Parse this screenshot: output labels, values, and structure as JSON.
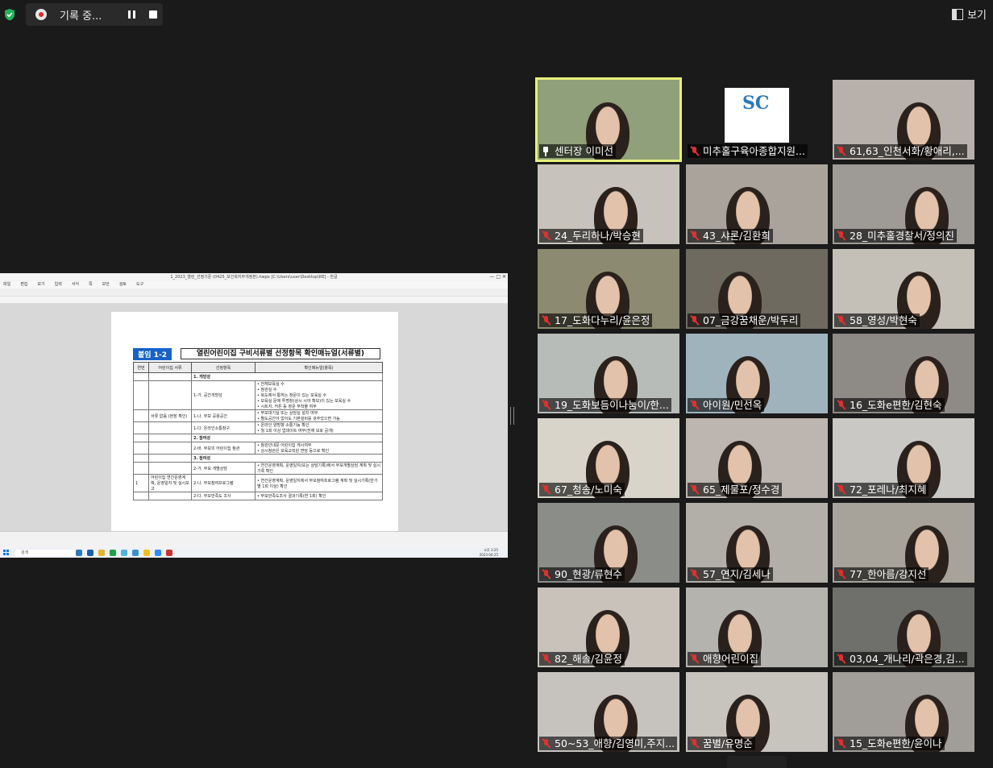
{
  "recording": {
    "label": "기록 중..."
  },
  "view_button": {
    "label": "보기"
  },
  "shared_screen": {
    "window_title": "1_2023_열린_선정기준 (0425_보건복지부개정본).hwpx [C:\\Users\\user\\Desktop\\RE] - 한글",
    "menu_items": [
      "파일",
      "편집",
      "보기",
      "입력",
      "서식",
      "쪽",
      "보안",
      "검토",
      "도구"
    ],
    "document": {
      "tag": "붙임 1-2",
      "heading": "열린어린이집 구비서류별 선정항목 확인매뉴얼(서류별)",
      "columns": [
        "연번",
        "어린이집 서류",
        "선정항목",
        "확인매뉴얼(항목)"
      ],
      "rows": [
        {
          "section": "1. 개방성",
          "item": "",
          "checks": []
        },
        {
          "section": "",
          "item": "1-가. 공간개방성",
          "checks": [
            "전체보육실 수",
            "참관실 수",
            "복도에서 통하는 창문이 있는 보육실 수",
            "보육실 문에 투명창(상시 시야 확보)이 있는 보육실 수",
            "시트지, 커튼 등 창문 부착물 여부"
          ]
        },
        {
          "section": "",
          "item": "1-나. 부모 공용공간",
          "checks": [
            "부모대기실 또는 상담실 설치 여부",
            "별도공간이 없어도 기본설비를 갖추었으면 가능"
          ]
        },
        {
          "section": "",
          "item": "1-다. 온라인소통창구",
          "checks": [
            "온라인 양방향 소통기능 확인",
            "월 1회 이상 업데이트 여부(전체 보호 공개)"
          ]
        },
        {
          "section": "2. 참여성",
          "item": "",
          "checks": []
        },
        {
          "section": "",
          "item": "2-바. 부모의 어린이집 참관",
          "checks": [
            "참관안내문 어린이집 게시여부",
            "상시참관은 보육교직원 면담 등으로 확인"
          ]
        },
        {
          "section": "3. 참여성",
          "item": "",
          "checks": []
        },
        {
          "section": "",
          "item": "2-가. 부모 개별상담",
          "checks": [
            "연간운영계획, 운영일지(또는 상담기록)에서 부모개별상담 계획 및 실시기록 확인"
          ]
        },
        {
          "section": "",
          "item": "2-나. 부모참여프로그램",
          "checks": [
            "연간운영계획, 운영일지에서 부모참여프로그램 계획 및 실시기록(반기별 1회 이상) 확인"
          ]
        },
        {
          "section": "",
          "item": "2-다. 부모만족도 조사",
          "checks": [
            "부모만족도조사 결과기록(연 1회) 확인"
          ]
        }
      ],
      "merged_labels": {
        "doc1": "서류 없음 (현장 확인)",
        "num2": "1",
        "doc2": "어린이집 연간운영계획, 운영일지 및 실시보고"
      }
    },
    "taskbar": {
      "search": "검색",
      "time": "오후 3:25",
      "date": "2023-04-25"
    }
  },
  "participants": [
    {
      "name": "센터장 이미선",
      "muted": false,
      "pinned": true,
      "active": true,
      "bg": "#8fa07a"
    },
    {
      "name": "미추홀구육아종합지원...",
      "muted": true,
      "logo": true,
      "bg": "#1b1b1b"
    },
    {
      "name": "61,63_인천서화/황애리,...",
      "muted": true,
      "bg": "#b8b0aa"
    },
    {
      "name": "24_두리하나/박승현",
      "muted": true,
      "bg": "#c7c2bb"
    },
    {
      "name": "43_샤론/김환희",
      "muted": true,
      "bg": "#a9a39c"
    },
    {
      "name": "28_미추홀경찰서/정의진",
      "muted": true,
      "bg": "#9e9a95"
    },
    {
      "name": "17_도화다누리/윤은정",
      "muted": true,
      "bg": "#8c8a70"
    },
    {
      "name": "07_금강꿈채운/박두리",
      "muted": true,
      "bg": "#6e6a60"
    },
    {
      "name": "58_영성/박현숙",
      "muted": true,
      "bg": "#c4c0b8"
    },
    {
      "name": "19_도화보듬이나눔이/한...",
      "muted": true,
      "bg": "#b7bcb9"
    },
    {
      "name": "아이원/민선옥",
      "muted": true,
      "bg": "#9fb3bd"
    },
    {
      "name": "16_도화e편한/김현숙",
      "muted": true,
      "bg": "#8e8a86"
    },
    {
      "name": "67_청송/노미숙",
      "muted": true,
      "bg": "#d8d4c9"
    },
    {
      "name": "65_제물포/정수경",
      "muted": true,
      "bg": "#bdb6b0"
    },
    {
      "name": "72_포레나/최지혜",
      "muted": true,
      "bg": "#c9c8c4"
    },
    {
      "name": "90_현광/류현수",
      "muted": true,
      "bg": "#8a8d88"
    },
    {
      "name": "57_연지/김세나",
      "muted": true,
      "bg": "#b2aea8"
    },
    {
      "name": "77_한아름/강지선",
      "muted": true,
      "bg": "#a7a39a"
    },
    {
      "name": "82_해솔/김윤정",
      "muted": true,
      "bg": "#c8c2bb"
    },
    {
      "name": "애향어린이집",
      "muted": true,
      "bg": "#b5b3ae"
    },
    {
      "name": "03,04_개나리/곽은경,김...",
      "muted": true,
      "bg": "#6f6f6c"
    },
    {
      "name": "50~53_애향/김영미,주지...",
      "muted": true,
      "bg": "#c6c3be"
    },
    {
      "name": "꿈별/유명순",
      "muted": true,
      "bg": "#c7c3bd"
    },
    {
      "name": "15_도화e편한/윤이나",
      "muted": true,
      "bg": "#a19d98"
    }
  ]
}
